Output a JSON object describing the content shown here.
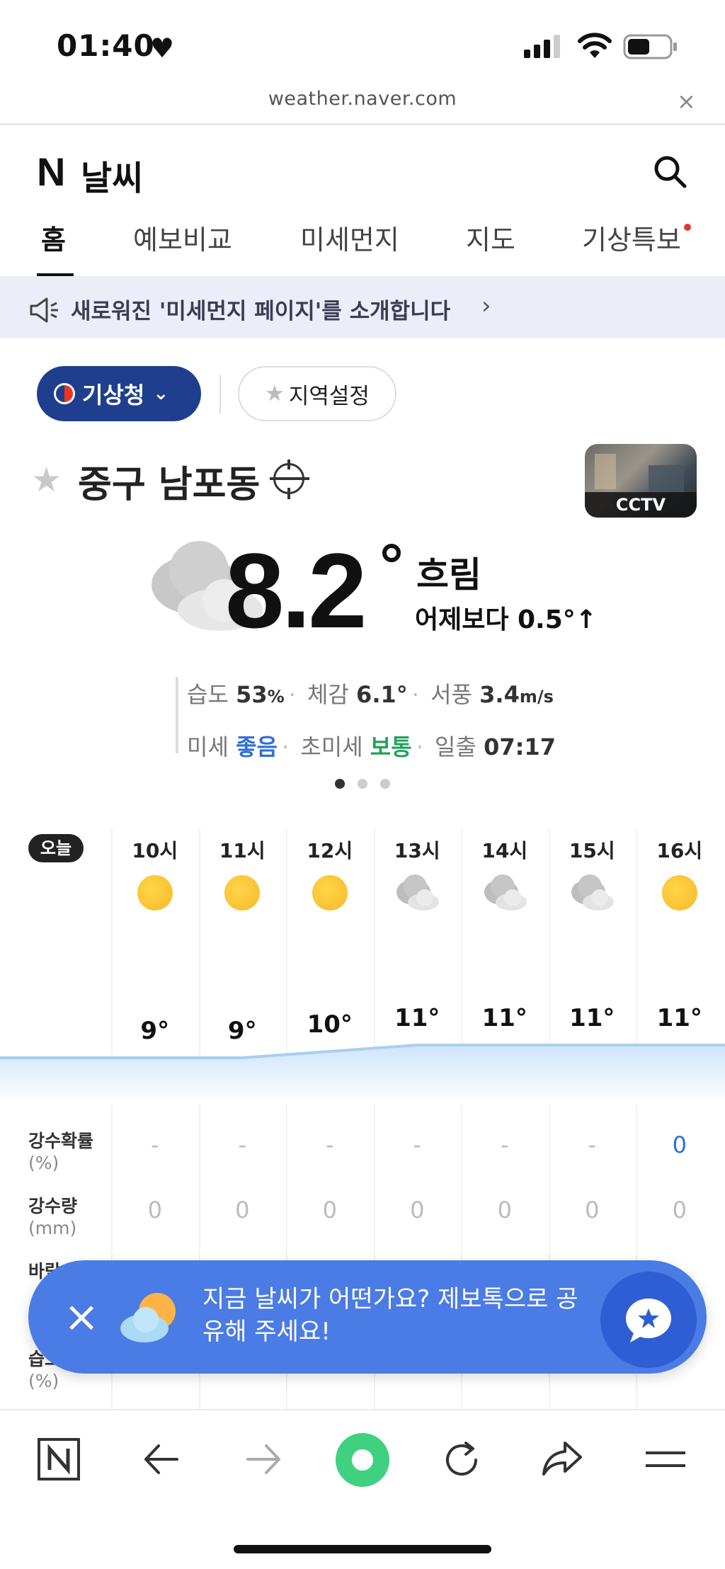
{
  "status_bar": {
    "time": "01:40"
  },
  "browser": {
    "url": "weather.naver.com",
    "close_label": "×"
  },
  "header": {
    "logo": "N",
    "title": "날씨"
  },
  "tabs": [
    {
      "label": "홈"
    },
    {
      "label": "예보비교"
    },
    {
      "label": "미세먼지"
    },
    {
      "label": "지도"
    },
    {
      "label": "기상특보"
    }
  ],
  "notice": {
    "text": "새로워진 '미세먼지 페이지'를 소개합니다"
  },
  "source": {
    "provider_label": "기상청",
    "region_setting_label": "지역설정"
  },
  "location": {
    "name": "중구 남포동",
    "cctv_label": "CCTV"
  },
  "current": {
    "temperature": "8.2",
    "condition": "흐림",
    "compare": "어제보다 0.5°↑",
    "humidity_label": "습도",
    "humidity_value": "53",
    "humidity_unit": "%",
    "feels_label": "체감",
    "feels_value": "6.1°",
    "wind_label": "서풍",
    "wind_value": "3.4",
    "wind_unit": "m/s",
    "pm_label": "미세",
    "pm_value": "좋음",
    "ultrafine_label": "초미세",
    "ultrafine_value": "보통",
    "sunrise_label": "일출",
    "sunrise_value": "07:17"
  },
  "hourly": {
    "today_label": "오늘",
    "hours": [
      {
        "time": "10시",
        "icon": "sun-icon",
        "temp": "9°",
        "precip_prob": "-",
        "precip_amount": "0"
      },
      {
        "time": "11시",
        "icon": "sun-icon",
        "temp": "9°",
        "precip_prob": "-",
        "precip_amount": "0"
      },
      {
        "time": "12시",
        "icon": "sun-icon",
        "temp": "10°",
        "precip_prob": "-",
        "precip_amount": "0"
      },
      {
        "time": "13시",
        "icon": "cloud-icon",
        "temp": "11°",
        "precip_prob": "-",
        "precip_amount": "0"
      },
      {
        "time": "14시",
        "icon": "cloud-icon",
        "temp": "11°",
        "precip_prob": "-",
        "precip_amount": "0"
      },
      {
        "time": "15시",
        "icon": "cloud-icon",
        "temp": "11°",
        "precip_prob": "-",
        "precip_amount": "0"
      },
      {
        "time": "16시",
        "icon": "sun-icon",
        "temp": "11°",
        "precip_prob": "0",
        "precip_amount": "0"
      }
    ],
    "rows": {
      "precip_prob_label": "강수확률",
      "precip_prob_unit": "(%)",
      "precip_amount_label": "강수량",
      "precip_amount_unit": "(mm)",
      "wind_label": "바람",
      "humidity_label": "습도",
      "humidity_unit": "(%)"
    }
  },
  "toast": {
    "text": "지금 날씨가 어떤가요? 제보톡으로 공유해 주세요!"
  },
  "colors": {
    "brand_blue": "#1f3f8e",
    "toast_blue": "#4b7be4",
    "good_blue": "#2f6fd6",
    "normal_green": "#24a05c",
    "notice_bg": "#ecedf8"
  }
}
